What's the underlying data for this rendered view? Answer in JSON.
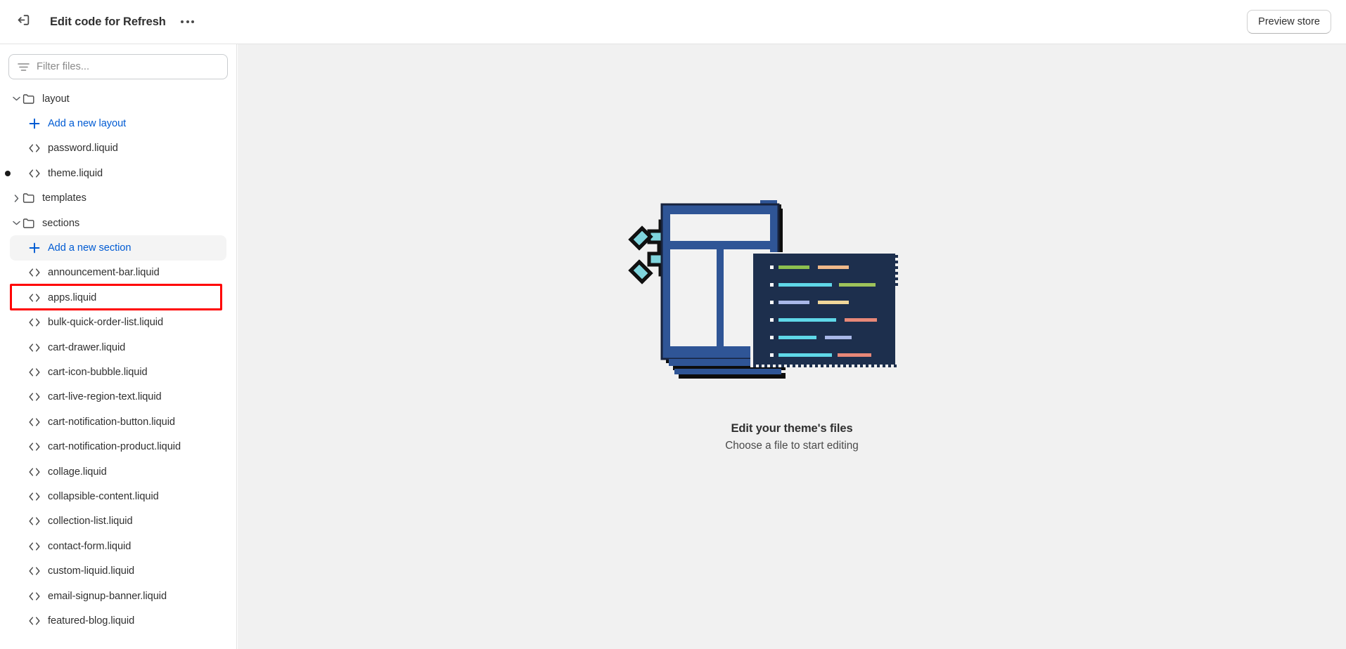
{
  "topbar": {
    "exit_icon": "exit-icon",
    "title": "Edit code for Refresh",
    "more_label": "•••",
    "preview_label": "Preview store"
  },
  "sidebar": {
    "filter": {
      "icon": "filter-icon",
      "placeholder": "Filter files...",
      "value": ""
    },
    "tree": [
      {
        "type": "folder",
        "label": "layout",
        "expanded": true,
        "icon": "folder-icon",
        "chevron": "chevron-down-icon"
      },
      {
        "type": "action",
        "label": "Add a new layout",
        "icon": "plus-icon"
      },
      {
        "type": "file",
        "label": "password.liquid",
        "icon": "code-icon",
        "modified": false
      },
      {
        "type": "file",
        "label": "theme.liquid",
        "icon": "code-icon",
        "modified": true
      },
      {
        "type": "folder",
        "label": "templates",
        "expanded": false,
        "icon": "folder-icon",
        "chevron": "chevron-right-icon"
      },
      {
        "type": "folder",
        "label": "sections",
        "expanded": true,
        "icon": "folder-icon",
        "chevron": "chevron-down-icon"
      },
      {
        "type": "action",
        "label": "Add a new section",
        "icon": "plus-icon",
        "highlighted": true
      },
      {
        "type": "file",
        "label": "announcement-bar.liquid",
        "icon": "code-icon"
      },
      {
        "type": "file",
        "label": "apps.liquid",
        "icon": "code-icon"
      },
      {
        "type": "file",
        "label": "bulk-quick-order-list.liquid",
        "icon": "code-icon"
      },
      {
        "type": "file",
        "label": "cart-drawer.liquid",
        "icon": "code-icon"
      },
      {
        "type": "file",
        "label": "cart-icon-bubble.liquid",
        "icon": "code-icon"
      },
      {
        "type": "file",
        "label": "cart-live-region-text.liquid",
        "icon": "code-icon"
      },
      {
        "type": "file",
        "label": "cart-notification-button.liquid",
        "icon": "code-icon"
      },
      {
        "type": "file",
        "label": "cart-notification-product.liquid",
        "icon": "code-icon"
      },
      {
        "type": "file",
        "label": "collage.liquid",
        "icon": "code-icon"
      },
      {
        "type": "file",
        "label": "collapsible-content.liquid",
        "icon": "code-icon"
      },
      {
        "type": "file",
        "label": "collection-list.liquid",
        "icon": "code-icon"
      },
      {
        "type": "file",
        "label": "contact-form.liquid",
        "icon": "code-icon"
      },
      {
        "type": "file",
        "label": "custom-liquid.liquid",
        "icon": "code-icon"
      },
      {
        "type": "file",
        "label": "email-signup-banner.liquid",
        "icon": "code-icon"
      },
      {
        "type": "file",
        "label": "featured-blog.liquid",
        "icon": "code-icon"
      }
    ],
    "scrollbar": {
      "up_icon": "scroll-up-arrow-icon",
      "down_icon": "scroll-down-arrow-icon"
    }
  },
  "main": {
    "illustration": "theme-code-editor-illustration",
    "title": "Edit your theme's files",
    "subtitle": "Choose a file to start editing"
  },
  "colors": {
    "link": "#005bd3",
    "annotation": "#ff0000",
    "canvas": "#f1f1f1",
    "text": "#303030",
    "illus_blue": "#2f5596",
    "illus_navy": "#1d2f4d",
    "illus_teal": "#7fd4dc",
    "code_green": "#8cc04f",
    "code_peach": "#f0b98a",
    "code_cyan": "#5fd8e8",
    "code_periwinkle": "#a8b8e8",
    "code_salmon": "#e88878"
  }
}
